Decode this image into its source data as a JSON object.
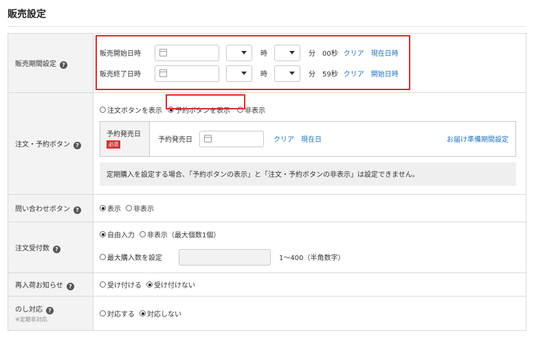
{
  "title": "販売設定",
  "help_glyph": "?",
  "sales_period": {
    "label": "販売期間設定",
    "start": {
      "label": "販売開始日時",
      "hour_unit": "時",
      "minute_unit": "分",
      "seconds": "00秒",
      "clear": "クリア",
      "now": "現在日時"
    },
    "end": {
      "label": "販売終了日時",
      "hour_unit": "時",
      "minute_unit": "分",
      "seconds": "59秒",
      "clear": "クリア",
      "now": "開始日時"
    }
  },
  "order_button": {
    "label": "注文・予約ボタン",
    "options": [
      "注文ボタンを表示",
      "予約ボタンを表示",
      "非表示"
    ],
    "selected": 1,
    "reservation_date": {
      "label": "予約発売日",
      "required": "必須",
      "field_label": "予約発売日",
      "clear": "クリア",
      "now": "現在日",
      "delivery_link": "お届け準備期間設定"
    },
    "note": "定期購入を設定する場合、「予約ボタンの表示」と「注文・予約ボタンの非表示」は設定できません。"
  },
  "inquiry_button": {
    "label": "問い合わせボタン",
    "options": [
      "表示",
      "非表示"
    ],
    "selected": 0
  },
  "order_quantity": {
    "label": "注文受付数",
    "options": [
      "自由入力",
      "非表示（最大個数1個）"
    ],
    "selected": 0,
    "max_option": "最大購入数を設定",
    "range_hint": "1〜400（半角数字）"
  },
  "restock_notice": {
    "label": "再入荷お知らせ",
    "options": [
      "受け付ける",
      "受け付けない"
    ],
    "selected": 1
  },
  "noshi": {
    "label": "のし対応",
    "sublabel": "※定期非対応",
    "options": [
      "対応する",
      "対応しない"
    ],
    "selected": 1
  }
}
